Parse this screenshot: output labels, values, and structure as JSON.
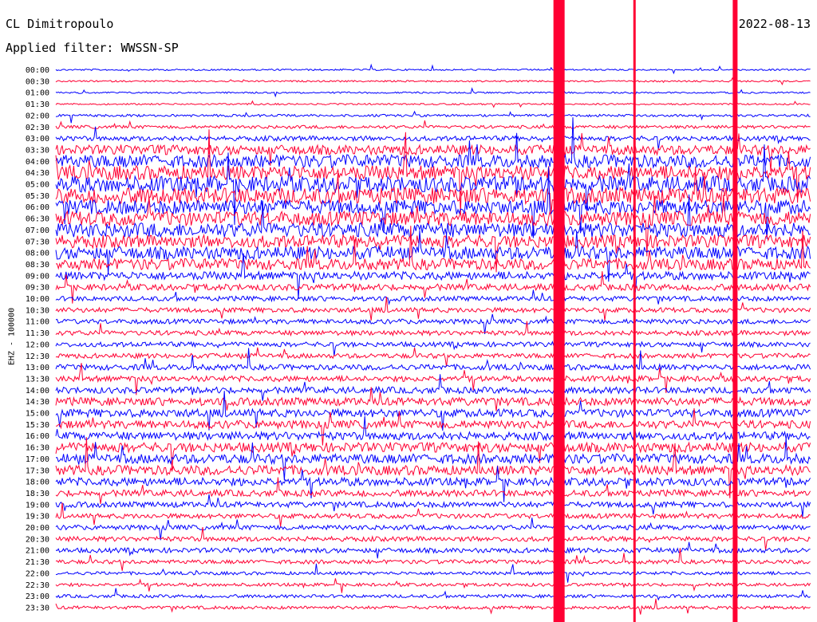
{
  "header": {
    "station": "CL Dimitropoulo",
    "date": "2022-08-13",
    "filter_label": "Applied filter: WWSSN-SP"
  },
  "chart_data": {
    "type": "line",
    "subtype": "helicorder",
    "ylabel": "EHZ - 100000",
    "row_labels": [
      "00:00",
      "00:30",
      "01:00",
      "01:30",
      "02:00",
      "02:30",
      "03:00",
      "03:30",
      "04:00",
      "04:30",
      "05:00",
      "05:30",
      "06:00",
      "06:30",
      "07:00",
      "07:30",
      "08:00",
      "08:30",
      "09:00",
      "09:30",
      "10:00",
      "10:30",
      "11:00",
      "11:30",
      "12:00",
      "12:30",
      "13:00",
      "13:30",
      "14:00",
      "14:30",
      "15:00",
      "15:30",
      "16:00",
      "16:30",
      "17:00",
      "17:30",
      "18:00",
      "18:30",
      "19:00",
      "19:30",
      "20:00",
      "20:30",
      "21:00",
      "21:30",
      "22:00",
      "22:30",
      "23:00",
      "23:30"
    ],
    "minutes_per_row": 30,
    "series_colors": [
      "#0000ff",
      "#ff0033"
    ],
    "noise_profile": [
      1,
      1,
      1,
      1,
      1.5,
      2,
      3,
      6,
      8,
      9,
      10,
      10,
      9,
      9,
      9,
      8,
      8,
      7,
      5,
      4,
      3,
      3,
      3,
      3,
      3,
      3,
      3.5,
      3.5,
      4,
      5,
      5,
      5,
      5,
      6,
      6,
      6,
      5,
      4,
      3.5,
      3,
      3,
      3,
      3,
      2.5,
      2,
      2,
      2,
      2
    ],
    "events": [
      {
        "minute": 20,
        "label": "saturated signal",
        "extent": "all rows"
      },
      {
        "minute": 23,
        "label": "spike",
        "extent": "all rows"
      },
      {
        "minute": 27,
        "label": "saturated signal",
        "extent": "all rows"
      }
    ]
  }
}
